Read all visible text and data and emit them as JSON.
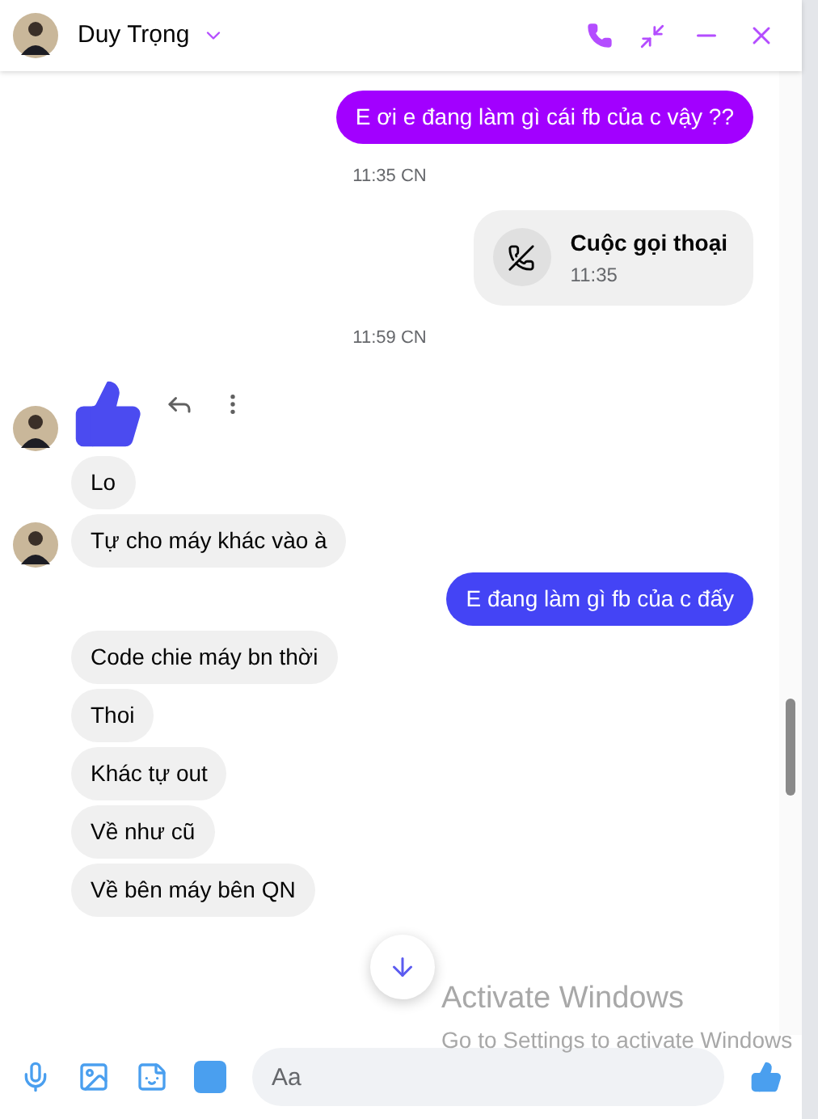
{
  "header": {
    "name": "Duy Trọng"
  },
  "messages": [
    {
      "kind": "outgoing",
      "text": "E ơi e đang làm gì cái fb của c vậy ??",
      "color": "#a200ff"
    },
    {
      "kind": "time",
      "text": "11:35 CN"
    },
    {
      "kind": "call",
      "title": "Cuộc gọi thoại",
      "time": "11:35"
    },
    {
      "kind": "time",
      "text": "11:59 CN"
    },
    {
      "kind": "like",
      "avatar": true
    },
    {
      "kind": "incoming",
      "text": "Lo",
      "avatar": false
    },
    {
      "kind": "incoming",
      "text": "Tự cho máy khác vào à",
      "avatar": true
    },
    {
      "kind": "outgoing",
      "text": "E đang làm gì fb của c đấy",
      "color": "#4444f5"
    },
    {
      "kind": "incoming",
      "text": "Code chie máy bn thời",
      "avatar": false
    },
    {
      "kind": "incoming",
      "text": "Thoi",
      "avatar": false
    },
    {
      "kind": "incoming",
      "text": "Khác tự out",
      "avatar": false
    },
    {
      "kind": "incoming",
      "text": "Về như cũ",
      "avatar": false
    },
    {
      "kind": "incoming",
      "text": "Về bên máy bên QN",
      "avatar": false
    }
  ],
  "composer": {
    "placeholder": "Aa"
  },
  "os_notice": {
    "title": "Activate Windows",
    "subtitle": "Go to Settings to activate Windows"
  }
}
